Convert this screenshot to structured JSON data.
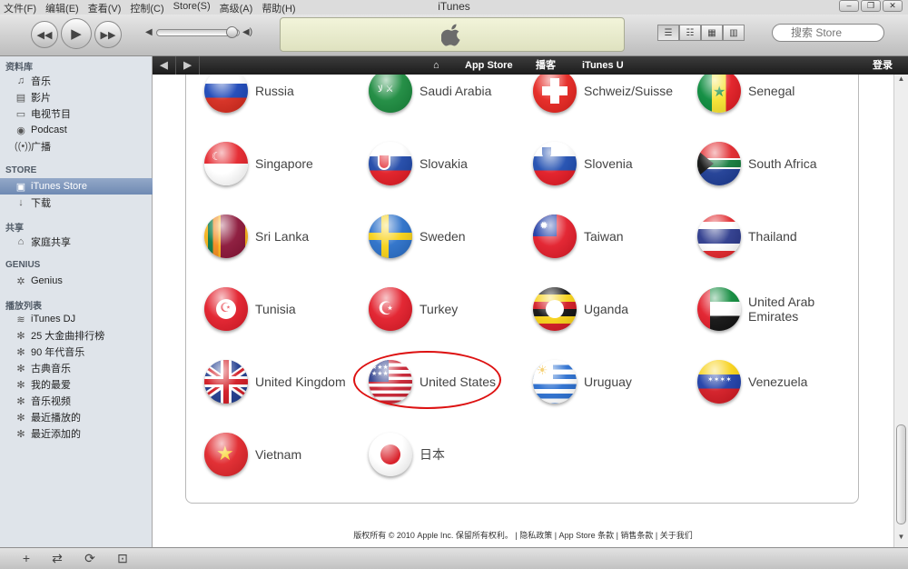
{
  "titlebar": {
    "menu": [
      "文件(F)",
      "编辑(E)",
      "查看(V)",
      "控制(C)",
      "Store(S)",
      "高级(A)",
      "帮助(H)"
    ],
    "title": "iTunes",
    "controls": [
      "minimize-icon",
      "restore-icon",
      "close-icon"
    ]
  },
  "toolbar": {
    "search_placeholder": "搜索 Store",
    "volume": 0.85,
    "icons": [
      "previous-icon",
      "play-icon",
      "next-icon",
      "apple-logo-icon"
    ]
  },
  "sidebar": {
    "sections": [
      {
        "title": "资料库",
        "items": [
          {
            "label": "音乐",
            "icon": "music-note-icon"
          },
          {
            "label": "影片",
            "icon": "film-icon"
          },
          {
            "label": "电视节目",
            "icon": "tv-icon"
          },
          {
            "label": "Podcast",
            "icon": "podcast-icon"
          },
          {
            "label": "广播",
            "icon": "radio-icon"
          }
        ]
      },
      {
        "title": "STORE",
        "items": [
          {
            "label": "iTunes Store",
            "icon": "store-icon",
            "selected": true
          },
          {
            "label": "下载",
            "icon": "download-icon"
          }
        ]
      },
      {
        "title": "共享",
        "items": [
          {
            "label": "家庭共享",
            "icon": "home-icon"
          }
        ]
      },
      {
        "title": "GENIUS",
        "items": [
          {
            "label": "Genius",
            "icon": "genius-icon"
          }
        ]
      },
      {
        "title": "播放列表",
        "items": [
          {
            "label": "iTunes DJ",
            "icon": "dj-icon"
          },
          {
            "label": "25 大金曲排行榜",
            "icon": "smart-playlist-icon"
          },
          {
            "label": "90 年代音乐",
            "icon": "smart-playlist-icon"
          },
          {
            "label": "古典音乐",
            "icon": "smart-playlist-icon"
          },
          {
            "label": "我的最爱",
            "icon": "smart-playlist-icon"
          },
          {
            "label": "音乐视频",
            "icon": "smart-playlist-icon"
          },
          {
            "label": "最近播放的",
            "icon": "smart-playlist-icon"
          },
          {
            "label": "最近添加的",
            "icon": "smart-playlist-icon"
          }
        ]
      }
    ]
  },
  "store_nav": {
    "links": [
      "App Store",
      "播客",
      "iTunes U"
    ],
    "login": "登录",
    "icons": [
      "back-arrow-icon",
      "forward-arrow-icon",
      "home-icon"
    ]
  },
  "countries": [
    {
      "name": "Russia",
      "flag": "russia-flag-icon"
    },
    {
      "name": "Saudi Arabia",
      "flag": "saudi-arabia-flag-icon"
    },
    {
      "name": "Schweiz/Suisse",
      "flag": "switzerland-flag-icon"
    },
    {
      "name": "Senegal",
      "flag": "senegal-flag-icon"
    },
    {
      "name": "Singapore",
      "flag": "singapore-flag-icon"
    },
    {
      "name": "Slovakia",
      "flag": "slovakia-flag-icon"
    },
    {
      "name": "Slovenia",
      "flag": "slovenia-flag-icon"
    },
    {
      "name": "South Africa",
      "flag": "south-africa-flag-icon"
    },
    {
      "name": "Sri Lanka",
      "flag": "sri-lanka-flag-icon"
    },
    {
      "name": "Sweden",
      "flag": "sweden-flag-icon"
    },
    {
      "name": "Taiwan",
      "flag": "taiwan-flag-icon"
    },
    {
      "name": "Thailand",
      "flag": "thailand-flag-icon"
    },
    {
      "name": "Tunisia",
      "flag": "tunisia-flag-icon"
    },
    {
      "name": "Turkey",
      "flag": "turkey-flag-icon"
    },
    {
      "name": "Uganda",
      "flag": "uganda-flag-icon"
    },
    {
      "name": "United Arab Emirates",
      "flag": "uae-flag-icon"
    },
    {
      "name": "United Kingdom",
      "flag": "uk-flag-icon"
    },
    {
      "name": "United States",
      "flag": "usa-flag-icon",
      "highlighted": true
    },
    {
      "name": "Uruguay",
      "flag": "uruguay-flag-icon"
    },
    {
      "name": "Venezuela",
      "flag": "venezuela-flag-icon"
    },
    {
      "name": "Vietnam",
      "flag": "vietnam-flag-icon"
    },
    {
      "name": "日本",
      "flag": "japan-flag-icon"
    }
  ],
  "footer": "版权所有 © 2010 Apple Inc. 保留所有权利。 | 隐私政策 | App Store 条款 | 销售条款 | 关于我们",
  "colors": {
    "highlight_circle": "#d11111",
    "sidebar_bg": "#dfe4ea",
    "nav_bg": "#2a2a2a",
    "selected_item": "#7f97bd"
  }
}
